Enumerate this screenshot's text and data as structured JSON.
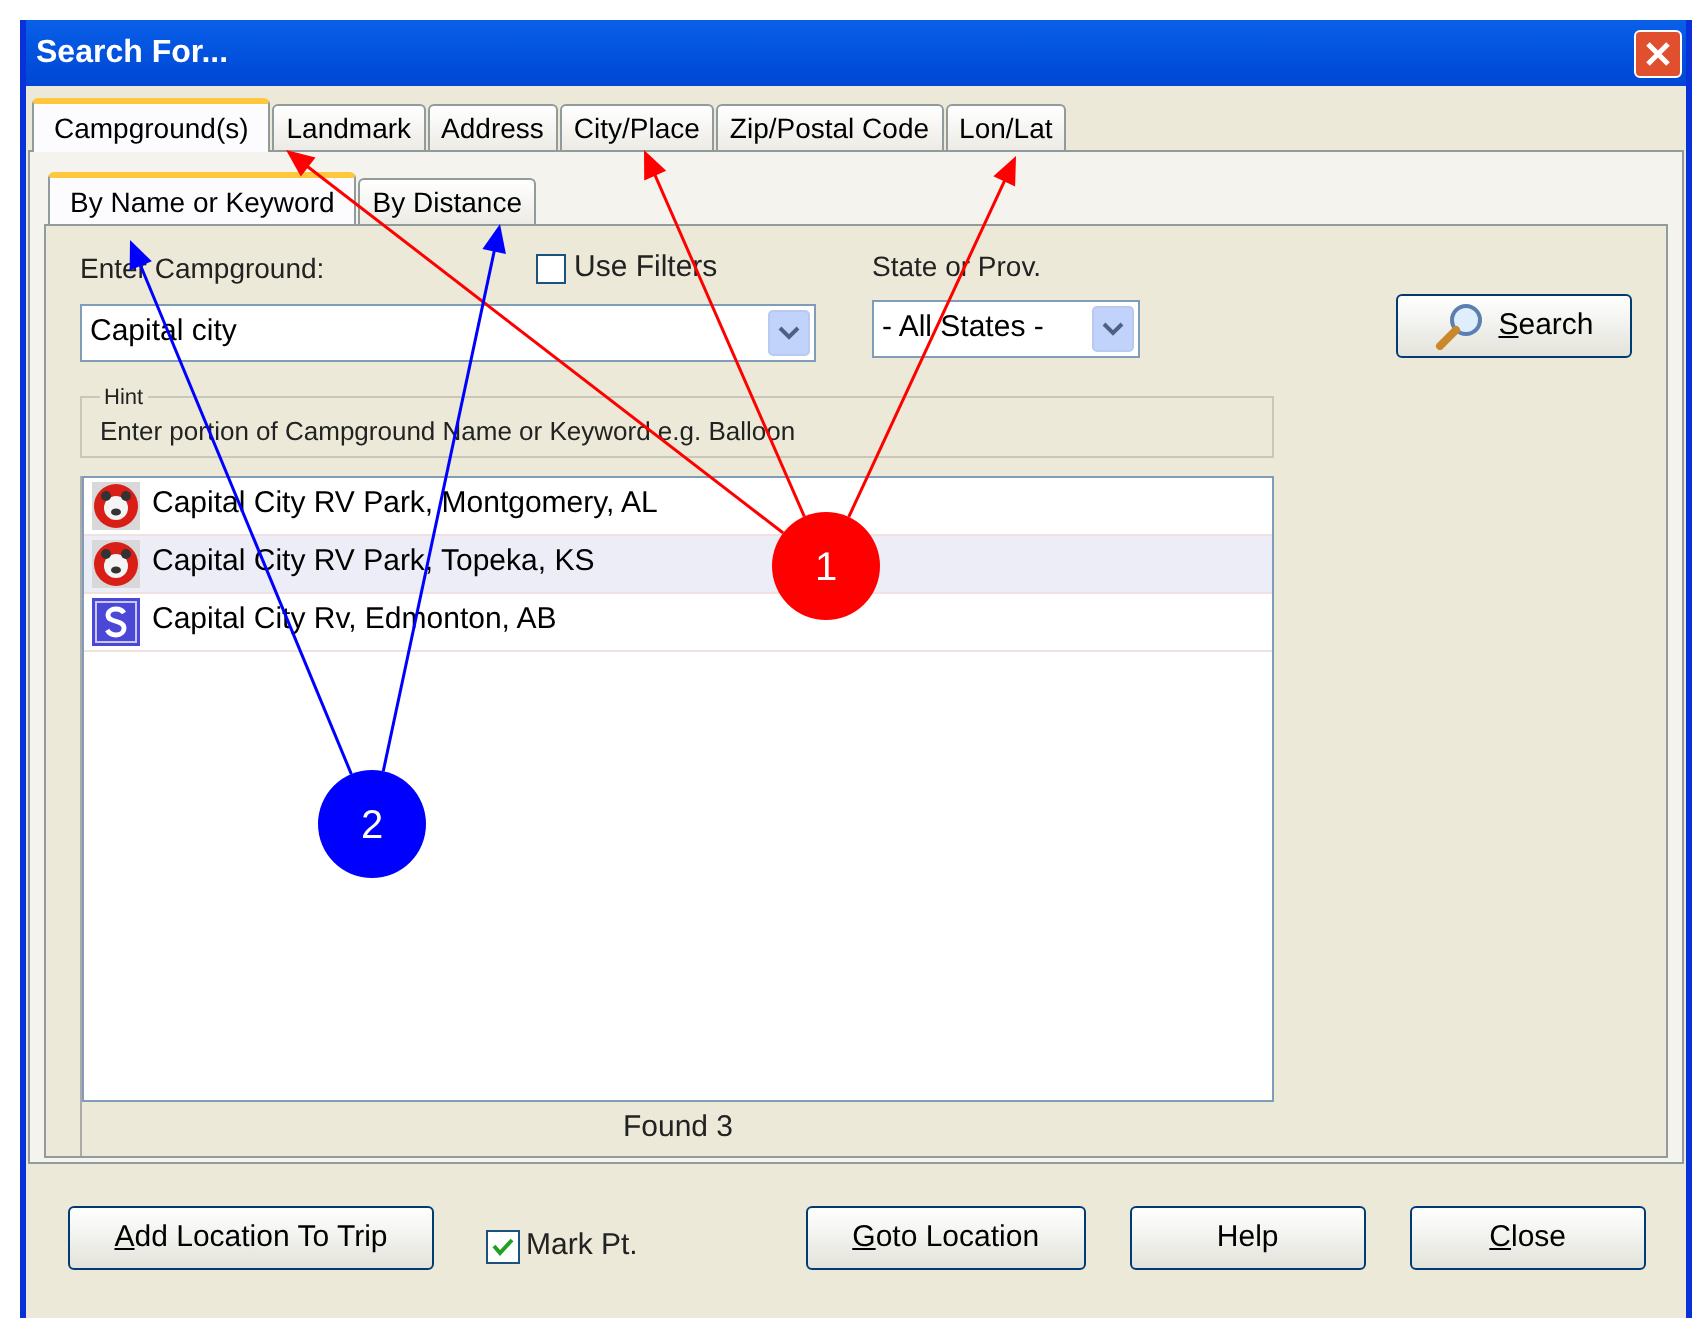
{
  "window": {
    "title": "Search For..."
  },
  "tabs": [
    {
      "label": "Campground(s)",
      "selected": true
    },
    {
      "label": "Landmark",
      "selected": false
    },
    {
      "label": "Address",
      "selected": false
    },
    {
      "label": "City/Place",
      "selected": false
    },
    {
      "label": "Zip/Postal Code",
      "selected": false
    },
    {
      "label": "Lon/Lat",
      "selected": false
    }
  ],
  "subtabs": [
    {
      "label": "By Name or Keyword",
      "selected": true
    },
    {
      "label": "By Distance",
      "selected": false
    }
  ],
  "campground_field": {
    "label": "Enter Campground:",
    "value": "Capital city"
  },
  "use_filters": {
    "label": "Use Filters",
    "checked": false
  },
  "state_field": {
    "label": "State or Prov.",
    "value": "- All States -"
  },
  "search_button": {
    "key": "S",
    "rest": "earch"
  },
  "hint": {
    "title": "Hint",
    "text": "Enter portion of Campground Name or  Keyword e.g. Balloon"
  },
  "results": [
    {
      "kind": "bear",
      "label": "Capital City RV Park, Montgomery, AL",
      "selected": false
    },
    {
      "kind": "bear",
      "label": "Capital City RV Park, Topeka, KS",
      "selected": true
    },
    {
      "kind": "s",
      "label": "Capital City Rv, Edmonton, AB",
      "selected": false
    }
  ],
  "found": "Found 3",
  "footer": {
    "buttons": [
      {
        "key": "A",
        "rest": "dd Location To Trip"
      },
      {
        "kind": "checkbox",
        "label": "Mark Pt.",
        "checked": true
      },
      {
        "key": "G",
        "rest": "oto Location"
      },
      {
        "rest": "Help"
      },
      {
        "key": "C",
        "rest": "lose"
      }
    ]
  },
  "annotations": [
    {
      "label": "1",
      "color": "#ff0000"
    },
    {
      "label": "2",
      "color": "#0000ff"
    }
  ]
}
